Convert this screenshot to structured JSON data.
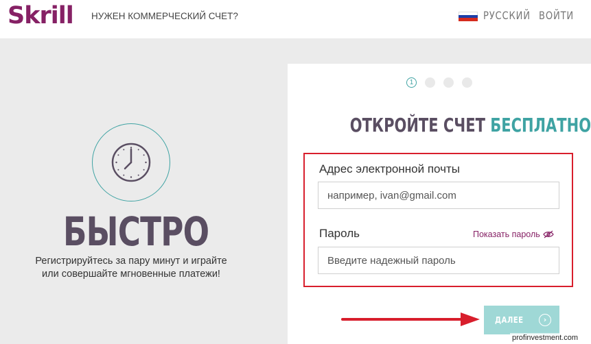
{
  "header": {
    "logo": "Skrill",
    "business_link": "НУЖЕН КОММЕРЧЕСКИЙ СЧЕТ?",
    "language": "РУССКИЙ",
    "login": "ВОЙТИ"
  },
  "promo": {
    "title": "БЫСТРО",
    "text": "Регистрируйтесь за пару минут и играйте или совершайте мгновенные платежи!"
  },
  "form": {
    "steps": [
      {
        "label": "1",
        "active": true
      },
      {
        "label": "",
        "active": false
      },
      {
        "label": "",
        "active": false
      },
      {
        "label": "",
        "active": false
      }
    ],
    "title_part1": "ОТКРОЙТЕ СЧЕТ",
    "title_part2": "БЕСПЛАТНО",
    "email_label": "Адрес электронной почты",
    "email_placeholder": "например, ivan@gmail.com",
    "password_label": "Пароль",
    "show_password": "Показать пароль",
    "password_placeholder": "Введите надежный пароль",
    "next_button": "ДАЛЕЕ"
  },
  "watermark": "profinvestment.com",
  "colors": {
    "brand": "#862165",
    "accent": "#3fa3a3",
    "button": "#9fd8d6",
    "highlight_frame": "#d81e2c"
  },
  "icons": [
    "clock-icon",
    "eye-slash-icon",
    "arrow-right-icon",
    "russian-flag-icon"
  ]
}
